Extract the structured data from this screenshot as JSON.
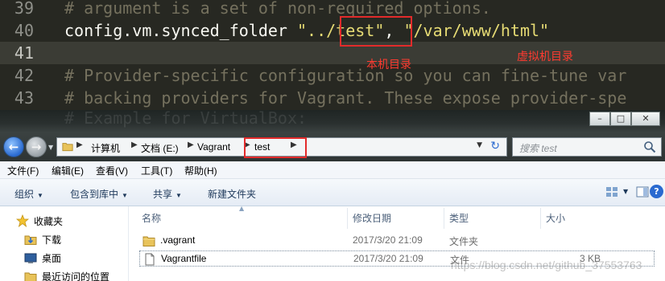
{
  "editor": {
    "lines": [
      {
        "num": "39",
        "comment": "# argument is a set of non-required options."
      },
      {
        "num": "40",
        "code_prefix": "config.vm.synced_folder ",
        "arg1": "\"../test\"",
        "sep": ", ",
        "arg2": "\"/var/www/html\""
      },
      {
        "num": "41"
      },
      {
        "num": "42",
        "comment": "# Provider-specific configuration so you can fine-tune var"
      },
      {
        "num": "43",
        "comment": "# backing providers for Vagrant. These expose provider-spe"
      }
    ],
    "ghost_line": "# Example for VirtualBox:",
    "annotation_left": "本机目录",
    "annotation_right": "虚拟机目录",
    "annotation_color": "#e32b2b"
  },
  "explorer": {
    "window_buttons": [
      "–",
      "□",
      "✕"
    ],
    "nav": {
      "back_icon": "back-arrow-icon",
      "forward_icon": "forward-arrow-icon"
    },
    "breadcrumb": [
      "计算机",
      "文档 (E:)",
      "Vagrant",
      "test"
    ],
    "search_placeholder": "搜索 test",
    "menu": [
      "文件(F)",
      "编辑(E)",
      "查看(V)",
      "工具(T)",
      "帮助(H)"
    ],
    "toolbar": [
      "组织",
      "包含到库中",
      "共享",
      "新建文件夹"
    ],
    "help_label": "?",
    "navpane": [
      "收藏夹",
      "下载",
      "桌面",
      "最近访问的位置"
    ],
    "columns": [
      "名称",
      "修改日期",
      "类型",
      "大小"
    ],
    "files": [
      {
        "name": ".vagrant",
        "date": "2017/3/20 21:09",
        "type": "文件夹",
        "size": "",
        "icon": "folder-icon"
      },
      {
        "name": "Vagrantfile",
        "date": "2017/3/20 21:09",
        "type": "文件",
        "size": "3 KB",
        "icon": "file-icon"
      }
    ]
  },
  "watermark": "https://blog.csdn.net/github_37553763"
}
